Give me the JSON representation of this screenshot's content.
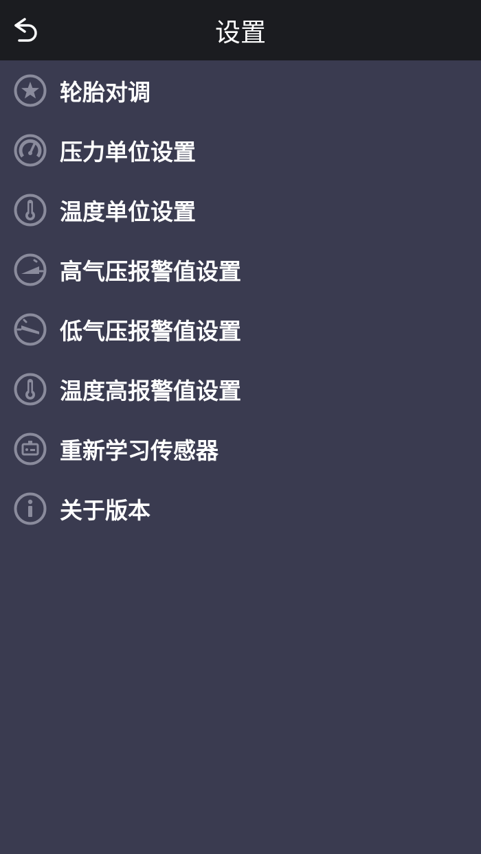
{
  "header": {
    "title": "设置",
    "back_icon": "back-arrow-icon"
  },
  "menu": {
    "items": [
      {
        "label": "轮胎对调",
        "icon": "star-icon"
      },
      {
        "label": "压力单位设置",
        "icon": "gauge-icon"
      },
      {
        "label": "温度单位设置",
        "icon": "thermometer-icon"
      },
      {
        "label": "高气压报警值设置",
        "icon": "high-pressure-gauge-icon"
      },
      {
        "label": "低气压报警值设置",
        "icon": "low-pressure-gauge-icon"
      },
      {
        "label": "温度高报警值设置",
        "icon": "thermometer-icon"
      },
      {
        "label": "重新学习传感器",
        "icon": "sensor-icon"
      },
      {
        "label": "关于版本",
        "icon": "info-icon"
      }
    ]
  },
  "colors": {
    "header_bg": "#1b1c20",
    "body_bg": "#3a3b50",
    "icon": "#8a8b9c",
    "text": "#ffffff"
  }
}
